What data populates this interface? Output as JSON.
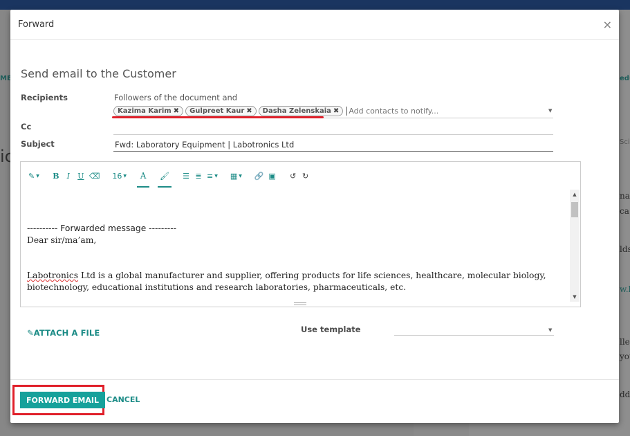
{
  "background": {
    "left_fragment": "ME",
    "left_big_fragment": "ic",
    "right_fragments": [
      "edul",
      "Scie",
      "na",
      "ca",
      "lds",
      "w.l",
      "ller",
      "you",
      "ddit"
    ]
  },
  "modal": {
    "title": "Forward",
    "heading": "Send email to the Customer"
  },
  "form": {
    "recipients_label": "Recipients",
    "followers_note": "Followers of the document and",
    "recipients": [
      "Kazima Karim",
      "Gulpreet Kaur",
      "Dasha Zelenskaia"
    ],
    "recipients_placeholder": "Add contacts to notify...",
    "cc_label": "Cc",
    "subject_label": "Subject",
    "subject_value": "Fwd: Laboratory Equipment | Labotronics Ltd"
  },
  "editor": {
    "toolbar": {
      "magic_icon": "magic-wand-icon",
      "bold": "B",
      "italic": "I",
      "underline": "U",
      "eraser_icon": "eraser-icon",
      "font_size": "16",
      "font_color": "A",
      "highlight_icon": "paint-brush-icon"
    },
    "forward_header": "---------- Forwarded message ---------",
    "greeting": "Dear sir/ma’am,",
    "company_word": "Labotronics",
    "body_rest": " Ltd is a global manufacturer and supplier, offering products for life sciences, healthcare, molecular biology, biotechnology, educational institutions and research laboratories, pharmaceuticals, etc."
  },
  "attach_label": "ATTACH A FILE",
  "template_label": "Use template",
  "footer": {
    "forward_label": "FORWARD EMAIL",
    "cancel_label": "CANCEL"
  },
  "colors": {
    "accent": "#16a19b",
    "link": "#1d8c87",
    "annotation_red": "#e0202a",
    "topbar": "#1a3560"
  }
}
